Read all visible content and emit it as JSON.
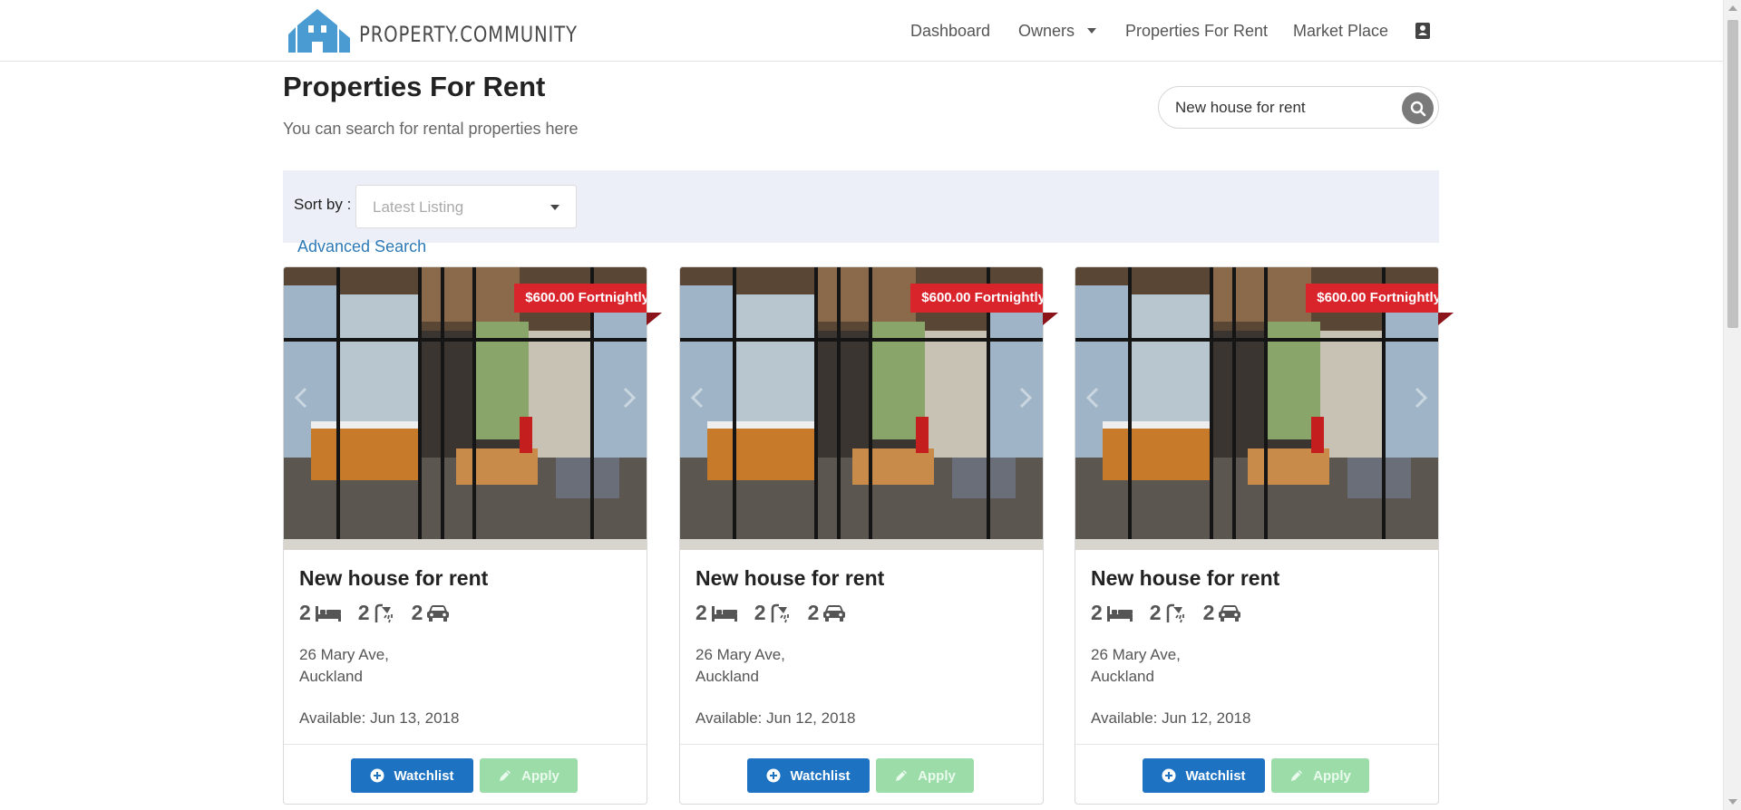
{
  "header": {
    "logo_text": "PROPERTY.COMMUNITY",
    "nav": [
      {
        "label": "Dashboard"
      },
      {
        "label": "Owners"
      },
      {
        "label": "Properties For Rent"
      },
      {
        "label": "Market Place"
      }
    ]
  },
  "page": {
    "title": "Properties For Rent",
    "subtitle": "You can search for rental properties here"
  },
  "search": {
    "value": "New house for rent"
  },
  "sort": {
    "label": "Sort by :",
    "selected": "Latest Listing"
  },
  "advanced_search": "Advanced Search",
  "listings": [
    {
      "price": "$600.00 Fortnightly",
      "title": "New house for rent",
      "bedrooms": "2",
      "bathrooms": "2",
      "parking": "2",
      "address_line1": "26 Mary Ave,",
      "address_line2": "Auckland",
      "available": "Available:  Jun 13, 2018",
      "watchlist_label": "Watchlist",
      "apply_label": "Apply"
    },
    {
      "price": "$600.00 Fortnightly",
      "title": "New house for rent",
      "bedrooms": "2",
      "bathrooms": "2",
      "parking": "2",
      "address_line1": "26 Mary Ave,",
      "address_line2": "Auckland",
      "available": "Available:  Jun 12, 2018",
      "watchlist_label": "Watchlist",
      "apply_label": "Apply"
    },
    {
      "price": "$600.00 Fortnightly",
      "title": "New house for rent",
      "bedrooms": "2",
      "bathrooms": "2",
      "parking": "2",
      "address_line1": "26 Mary Ave,",
      "address_line2": "Auckland",
      "available": "Available:  Jun 12, 2018",
      "watchlist_label": "Watchlist",
      "apply_label": "Apply"
    }
  ],
  "colors": {
    "brand_blue": "#4b9bd3",
    "price_red": "#d9242c",
    "watchlist_blue": "#1d72c2",
    "apply_green": "#9bdca8",
    "link_blue": "#2d7ab6",
    "sort_bar_bg": "#eceff7"
  }
}
